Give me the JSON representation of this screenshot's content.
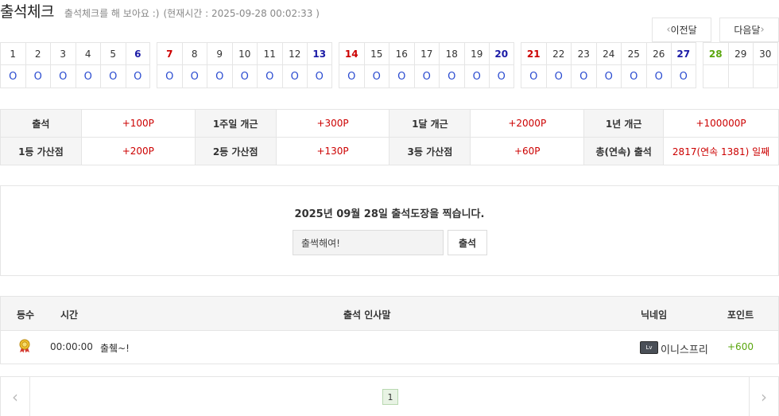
{
  "header": {
    "title": "출석체크",
    "subtitle": "출석체크를 해 보아요 :)",
    "current_time": "(현재시간 : 2025-09-28 00:02:33 )"
  },
  "nav": {
    "prev_label": "이전달",
    "next_label": "다음달",
    "prev_icon": "chevron-left-icon",
    "next_icon": "chevron-right-icon"
  },
  "calendar": {
    "weeks": [
      [
        {
          "day": "1",
          "mark": "O",
          "type": "weekday"
        },
        {
          "day": "2",
          "mark": "O",
          "type": "weekday"
        },
        {
          "day": "3",
          "mark": "O",
          "type": "weekday"
        },
        {
          "day": "4",
          "mark": "O",
          "type": "weekday"
        },
        {
          "day": "5",
          "mark": "O",
          "type": "weekday"
        },
        {
          "day": "6",
          "mark": "O",
          "type": "sat"
        }
      ],
      [
        {
          "day": "7",
          "mark": "O",
          "type": "sun"
        },
        {
          "day": "8",
          "mark": "O",
          "type": "weekday"
        },
        {
          "day": "9",
          "mark": "O",
          "type": "weekday"
        },
        {
          "day": "10",
          "mark": "O",
          "type": "weekday"
        },
        {
          "day": "11",
          "mark": "O",
          "type": "weekday"
        },
        {
          "day": "12",
          "mark": "O",
          "type": "weekday"
        },
        {
          "day": "13",
          "mark": "O",
          "type": "sat"
        }
      ],
      [
        {
          "day": "14",
          "mark": "O",
          "type": "sun"
        },
        {
          "day": "15",
          "mark": "O",
          "type": "weekday"
        },
        {
          "day": "16",
          "mark": "O",
          "type": "weekday"
        },
        {
          "day": "17",
          "mark": "O",
          "type": "weekday"
        },
        {
          "day": "18",
          "mark": "O",
          "type": "weekday"
        },
        {
          "day": "19",
          "mark": "O",
          "type": "weekday"
        },
        {
          "day": "20",
          "mark": "O",
          "type": "sat"
        }
      ],
      [
        {
          "day": "21",
          "mark": "O",
          "type": "sun"
        },
        {
          "day": "22",
          "mark": "O",
          "type": "weekday"
        },
        {
          "day": "23",
          "mark": "O",
          "type": "weekday"
        },
        {
          "day": "24",
          "mark": "O",
          "type": "weekday"
        },
        {
          "day": "25",
          "mark": "O",
          "type": "weekday"
        },
        {
          "day": "26",
          "mark": "O",
          "type": "weekday"
        },
        {
          "day": "27",
          "mark": "O",
          "type": "sat"
        }
      ],
      [
        {
          "day": "28",
          "mark": "",
          "type": "today"
        },
        {
          "day": "29",
          "mark": "",
          "type": "weekday"
        },
        {
          "day": "30",
          "mark": "",
          "type": "weekday"
        }
      ]
    ]
  },
  "points_table": {
    "rows": [
      [
        {
          "label": "출석",
          "value": "+100P"
        },
        {
          "label": "1주일 개근",
          "value": "+300P"
        },
        {
          "label": "1달 개근",
          "value": "+2000P"
        },
        {
          "label": "1년 개근",
          "value": "+100000P"
        }
      ],
      [
        {
          "label": "1등 가산점",
          "value": "+200P"
        },
        {
          "label": "2등 가산점",
          "value": "+130P"
        },
        {
          "label": "3등 가산점",
          "value": "+60P"
        },
        {
          "label": "총(연속) 출석",
          "value": "2817(연속 1381) 일째"
        }
      ]
    ]
  },
  "attendance_form": {
    "message": "2025년 09월 28일 출석도장을 찍습니다.",
    "input_value": "출썩해여!",
    "submit_label": "출석"
  },
  "list": {
    "headers": {
      "rank": "등수",
      "time": "시간",
      "greeting": "출석 인사말",
      "nickname": "닉네임",
      "point": "포인트"
    },
    "rows": [
      {
        "rank_icon": "gold-medal-icon",
        "time": "00:00:00",
        "greeting": "출췤~!",
        "level_icon": "level-badge-icon",
        "nickname": "이니스프리",
        "point": "+600"
      }
    ]
  },
  "pagination": {
    "current_page": "1",
    "prev_icon": "chevron-left-icon",
    "next_icon": "chevron-right-icon"
  },
  "colors": {
    "saturday": "#1a1aa6",
    "sunday": "#cc0000",
    "today": "#5aa60e",
    "mark": "#2a4bd0",
    "point_value": "#cc0000",
    "earned_point": "#5aa60e",
    "border": "#e5e5e5",
    "label_bg": "#f5f5f5"
  }
}
